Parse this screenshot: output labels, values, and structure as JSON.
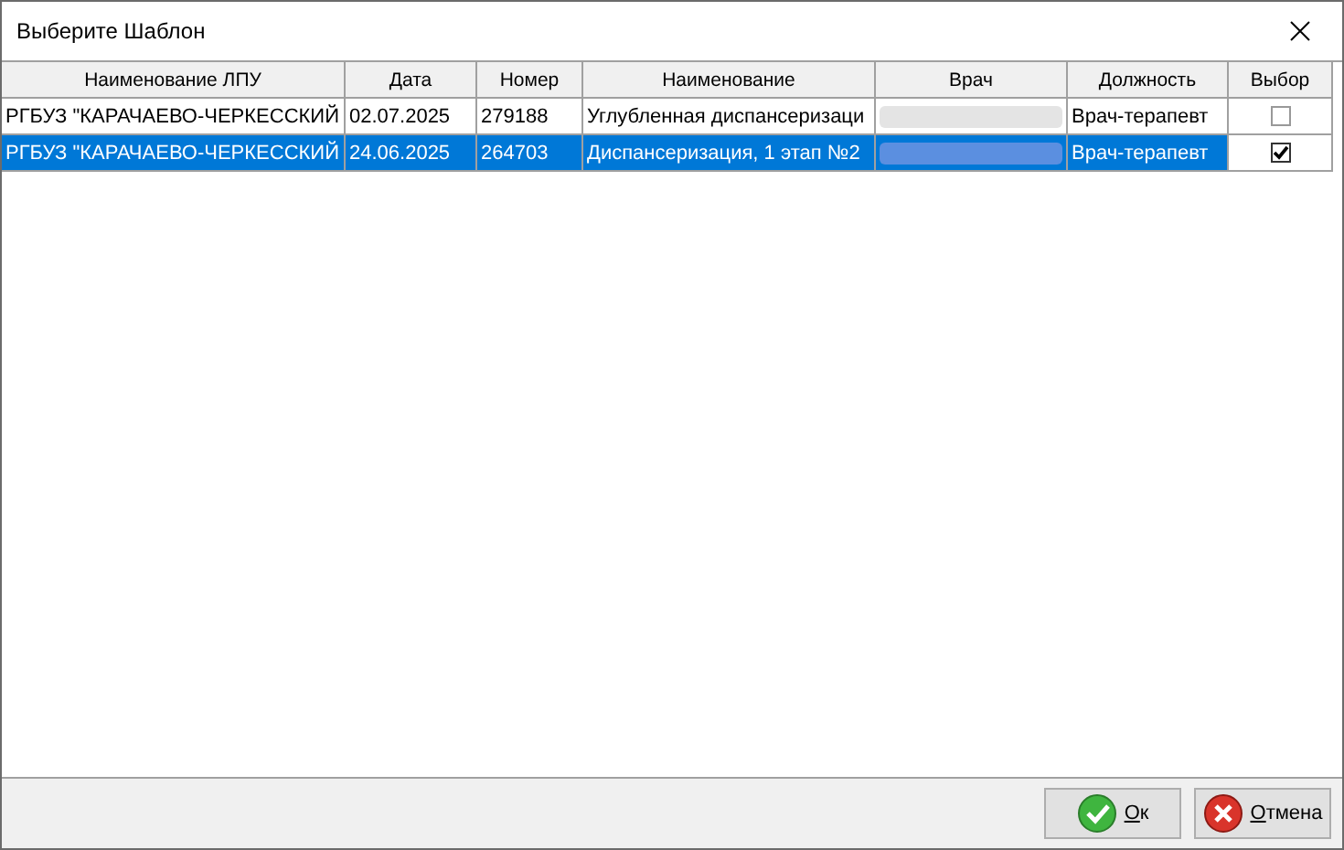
{
  "window": {
    "title": "Выберите Шаблон"
  },
  "table": {
    "columns": [
      "Наименование ЛПУ",
      "Дата",
      "Номер",
      "Наименование",
      "Врач",
      "Должность",
      "Выбор"
    ],
    "rows": [
      {
        "lpu": "РГБУЗ \"КАРАЧАЕВО-ЧЕРКЕССКИЙ",
        "date": "02.07.2025",
        "number": "279188",
        "name": "Углубленная диспансеризаци",
        "position": "Врач-терапевт",
        "checked": false,
        "selected": false
      },
      {
        "lpu": "РГБУЗ \"КАРАЧАЕВО-ЧЕРКЕССКИЙ",
        "date": "24.06.2025",
        "number": "264703",
        "name": "Диспансеризация, 1 этап №2",
        "position": "Врач-терапевт",
        "checked": true,
        "selected": true
      }
    ]
  },
  "buttons": [
    {
      "kind": "ok",
      "label": "Ок"
    },
    {
      "kind": "cancel",
      "label": "Отмена"
    }
  ]
}
